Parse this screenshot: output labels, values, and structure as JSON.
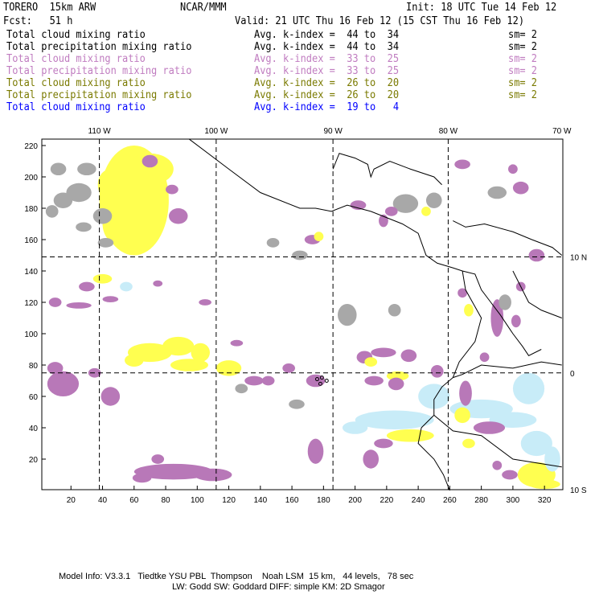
{
  "header": {
    "model": "TORERO  15km ARW",
    "org": "NCAR/MMM",
    "init": "Init: 18 UTC Tue 14 Feb 12",
    "fcst": "Fcst:   51 h",
    "valid": "Valid: 21 UTC Thu 16 Feb 12 (15 CST Thu 16 Feb 12)"
  },
  "legend": [
    {
      "field": "Total cloud mixing ratio",
      "range": "Avg. k-index =  44 to  34",
      "sm": "sm= 2",
      "color": "#000000"
    },
    {
      "field": "Total precipitation mixing ratio",
      "range": "Avg. k-index =  44 to  34",
      "sm": "sm= 2",
      "color": "#000000"
    },
    {
      "field": "Total cloud mixing ratio",
      "range": "Avg. k-index =  33 to  25",
      "sm": "sm= 2",
      "color": "#c07cc0"
    },
    {
      "field": "Total precipitation mixing ratio",
      "range": "Avg. k-index =  33 to  25",
      "sm": "sm= 2",
      "color": "#c07cc0"
    },
    {
      "field": "Total cloud mixing ratio",
      "range": "Avg. k-index =  26 to  20",
      "sm": "sm= 2",
      "color": "#7a7a00"
    },
    {
      "field": "Total precipitation mixing ratio",
      "range": "Avg. k-index =  26 to  20",
      "sm": "sm= 2",
      "color": "#7a7a00"
    },
    {
      "field": "Total cloud mixing ratio",
      "range": "Avg. k-index =  19 to   4",
      "sm": "",
      "color": "#0000ff"
    }
  ],
  "chart_data": {
    "type": "heatmap",
    "x_ticks": [
      20,
      40,
      60,
      80,
      100,
      120,
      140,
      160,
      180,
      200,
      220,
      240,
      260,
      280,
      300,
      320
    ],
    "y_ticks": [
      20,
      40,
      60,
      80,
      100,
      120,
      140,
      160,
      180,
      200,
      220
    ],
    "xlim": [
      0,
      331
    ],
    "ylim": [
      0,
      223
    ],
    "lon_labels": [
      {
        "label": "110 W",
        "x": 38
      },
      {
        "label": "100 W",
        "x": 112
      },
      {
        "label": "90 W",
        "x": 186
      },
      {
        "label": "80 W",
        "x": 259
      },
      {
        "label": "70 W",
        "x": 331
      }
    ],
    "lat_labels": [
      {
        "label": "10 N",
        "y": 149
      },
      {
        "label": "0",
        "y": 75
      },
      {
        "label": "10 S",
        "y": 0
      }
    ],
    "grid_x": [
      38,
      112,
      186,
      259
    ],
    "grid_y": [
      149,
      75
    ],
    "colors": {
      "gray": "#a8a8a8",
      "purple": "#b878b8",
      "yellow": "#ffff50",
      "lightblue": "#c8ecf8",
      "darkgray": "#606060"
    }
  },
  "footer": {
    "line1": "Model Info: V3.3.1   Tiedtke YSU PBL  Thompson    Noah LSM  15 km,   44 levels,   78 sec",
    "line2": "LW: Godd SW: Goddard DIFF: simple KM: 2D Smagor"
  }
}
